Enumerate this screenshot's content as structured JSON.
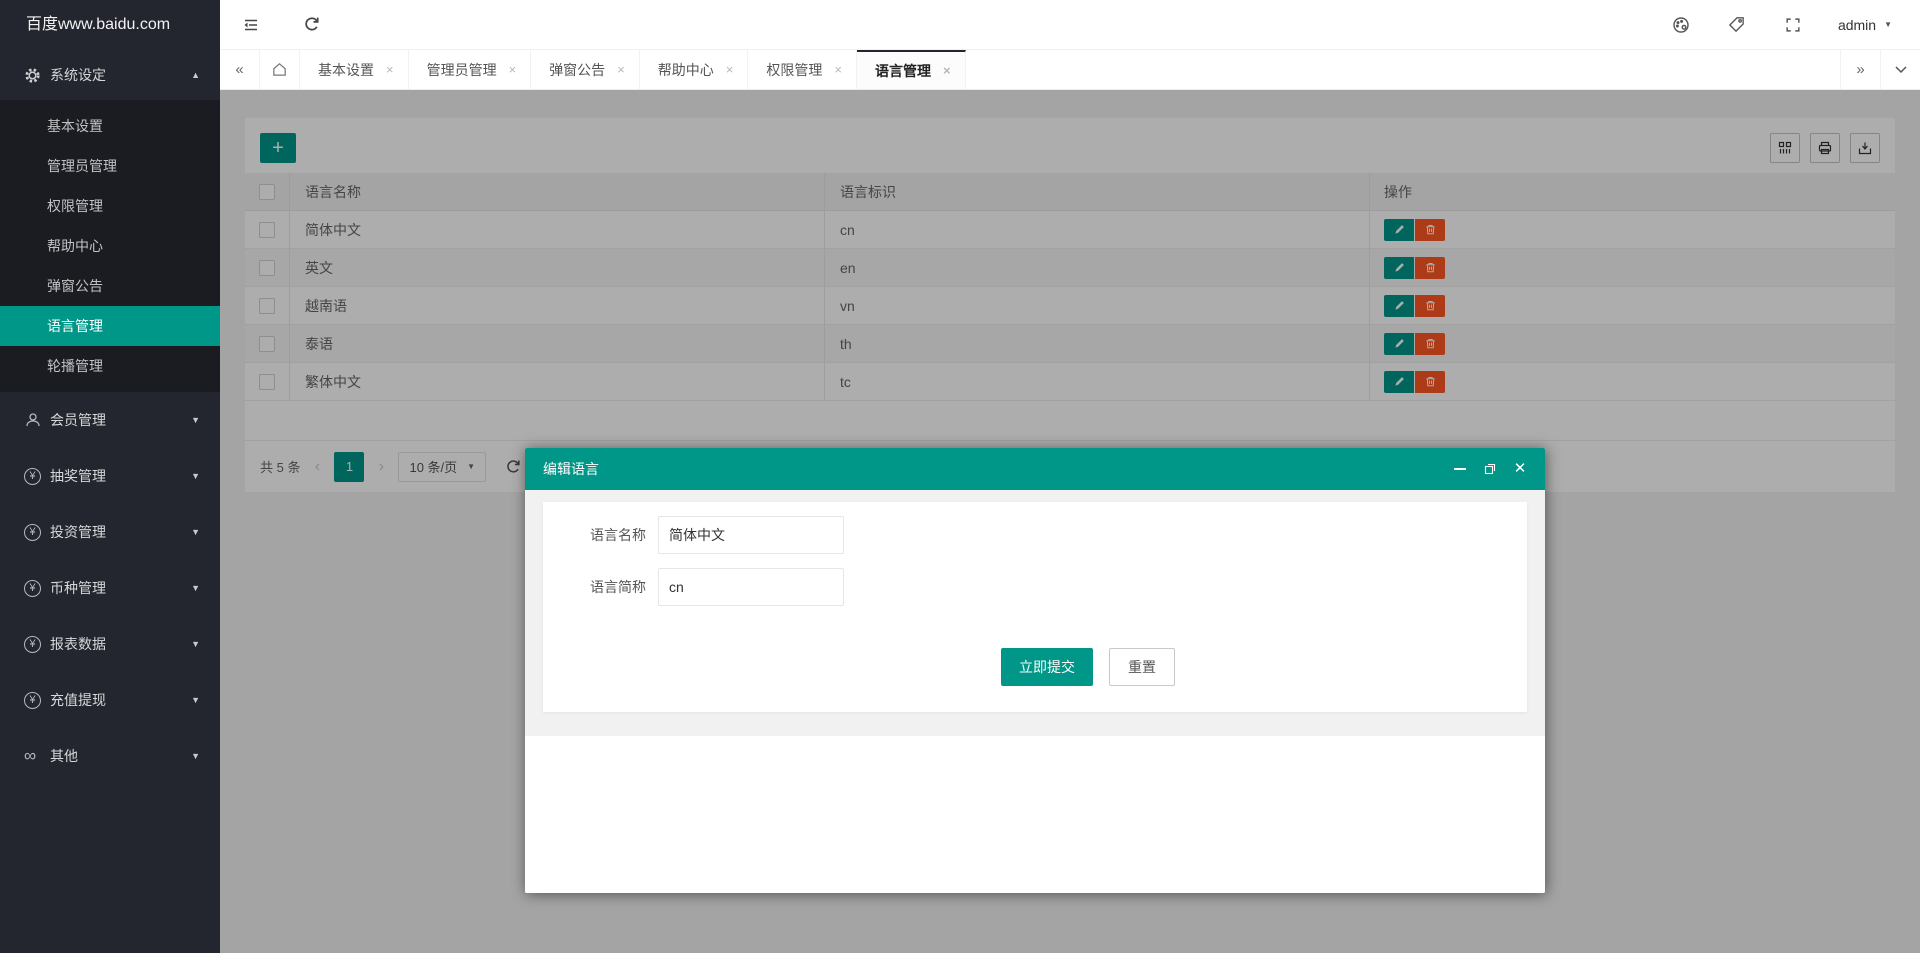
{
  "colors": {
    "accent": "#009688",
    "danger": "#FF5722",
    "dark": "#23262E",
    "mask": "rgba(0,0,0,0.32)"
  },
  "header": {
    "logo": "百度www.baidu.com",
    "username": "admin",
    "icons": [
      "collapse-menu",
      "refresh",
      "palette",
      "tag",
      "fullscreen"
    ]
  },
  "tabbar": {
    "tabs": [
      {
        "label": "基本设置"
      },
      {
        "label": "管理员管理"
      },
      {
        "label": "弹窗公告"
      },
      {
        "label": "帮助中心"
      },
      {
        "label": "权限管理"
      },
      {
        "label": "语言管理",
        "active": true
      }
    ],
    "close_glyph": "×"
  },
  "sidebar": {
    "parent": {
      "label": "系统设定"
    },
    "children": [
      {
        "label": "基本设置"
      },
      {
        "label": "管理员管理"
      },
      {
        "label": "权限管理"
      },
      {
        "label": "帮助中心"
      },
      {
        "label": "弹窗公告"
      },
      {
        "label": "语言管理",
        "active": true
      },
      {
        "label": "轮播管理"
      }
    ],
    "groups": [
      {
        "icon": "user",
        "label": "会员管理"
      },
      {
        "icon": "yen",
        "label": "抽奖管理"
      },
      {
        "icon": "yen",
        "label": "投资管理"
      },
      {
        "icon": "yen",
        "label": "币种管理"
      },
      {
        "icon": "yen",
        "label": "报表数据"
      },
      {
        "icon": "yen",
        "label": "充值提现"
      },
      {
        "icon": "infinity",
        "label": "其他"
      }
    ],
    "yen_glyph": "¥",
    "infinity_glyph": "∞",
    "arrow_up": "▲",
    "arrow_down": "▼"
  },
  "toolbar": {
    "add_label": "+"
  },
  "table": {
    "columns": [
      "语言名称",
      "语言标识",
      "操作"
    ],
    "rows": [
      {
        "name": "简体中文",
        "code": "cn"
      },
      {
        "name": "英文",
        "code": "en"
      },
      {
        "name": "越南语",
        "code": "vn"
      },
      {
        "name": "泰语",
        "code": "th"
      },
      {
        "name": "繁体中文",
        "code": "tc"
      }
    ]
  },
  "pagination": {
    "total": "共 5 条",
    "prev": "‹",
    "page": "1",
    "next": "›",
    "page_size": "10 条/页"
  },
  "modal": {
    "title": "编辑语言",
    "fields": [
      {
        "label": "语言名称",
        "value": "简体中文"
      },
      {
        "label": "语言简称",
        "value": "cn"
      }
    ],
    "submit": "立即提交",
    "reset": "重置",
    "close_glyph": "✕"
  }
}
